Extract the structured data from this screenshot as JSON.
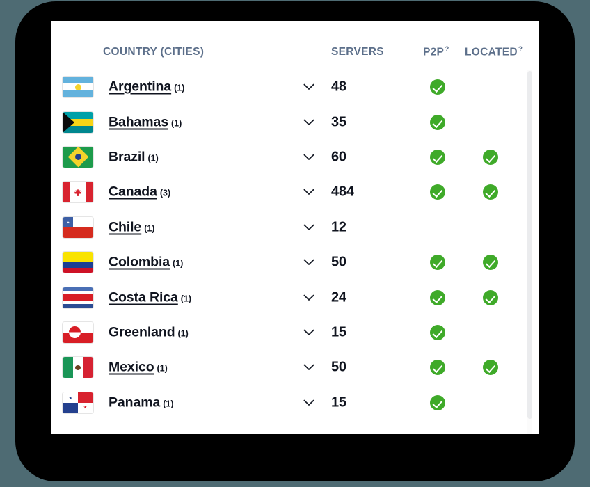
{
  "panel": {
    "headers": {
      "country": "COUNTRY (CITIES)",
      "servers": "SERVERS",
      "p2p": "P2P",
      "p2p_help": "?",
      "located": "LOCATED",
      "located_help": "?"
    },
    "colors": {
      "header_text": "#5c6f8a",
      "row_text": "#10141f",
      "check_green": "#3faa29",
      "page_background": "#4e6b73",
      "device_frame": "#000000",
      "card_background": "#ffffff",
      "scrollbar_thumb": "#ebecee"
    },
    "chevron_icon": "chevron-down-icon",
    "check_icon": "check-circle-icon",
    "rows": [
      {
        "country": "Argentina",
        "cities": "(1)",
        "servers": "48",
        "p2p": true,
        "located": false,
        "linked": true,
        "flag_code": "ar",
        "flag_name": "flag-argentina"
      },
      {
        "country": "Bahamas",
        "cities": "(1)",
        "servers": "35",
        "p2p": true,
        "located": false,
        "linked": true,
        "flag_code": "bs",
        "flag_name": "flag-bahamas"
      },
      {
        "country": "Brazil",
        "cities": "(1)",
        "servers": "60",
        "p2p": true,
        "located": true,
        "linked": false,
        "flag_code": "br",
        "flag_name": "flag-brazil"
      },
      {
        "country": "Canada",
        "cities": "(3)",
        "servers": "484",
        "p2p": true,
        "located": true,
        "linked": true,
        "flag_code": "ca",
        "flag_name": "flag-canada"
      },
      {
        "country": "Chile",
        "cities": "(1)",
        "servers": "12",
        "p2p": false,
        "located": false,
        "linked": true,
        "flag_code": "cl",
        "flag_name": "flag-chile"
      },
      {
        "country": "Colombia",
        "cities": "(1)",
        "servers": "50",
        "p2p": true,
        "located": true,
        "linked": true,
        "flag_code": "co",
        "flag_name": "flag-colombia"
      },
      {
        "country": "Costa Rica",
        "cities": "(1)",
        "servers": "24",
        "p2p": true,
        "located": true,
        "linked": true,
        "flag_code": "cr",
        "flag_name": "flag-costa-rica"
      },
      {
        "country": "Greenland",
        "cities": "(1)",
        "servers": "15",
        "p2p": true,
        "located": false,
        "linked": false,
        "flag_code": "gl",
        "flag_name": "flag-greenland"
      },
      {
        "country": "Mexico",
        "cities": "(1)",
        "servers": "50",
        "p2p": true,
        "located": true,
        "linked": true,
        "flag_code": "mx",
        "flag_name": "flag-mexico"
      },
      {
        "country": "Panama",
        "cities": "(1)",
        "servers": "15",
        "p2p": true,
        "located": false,
        "linked": false,
        "flag_code": "pa",
        "flag_name": "flag-panama"
      }
    ]
  }
}
